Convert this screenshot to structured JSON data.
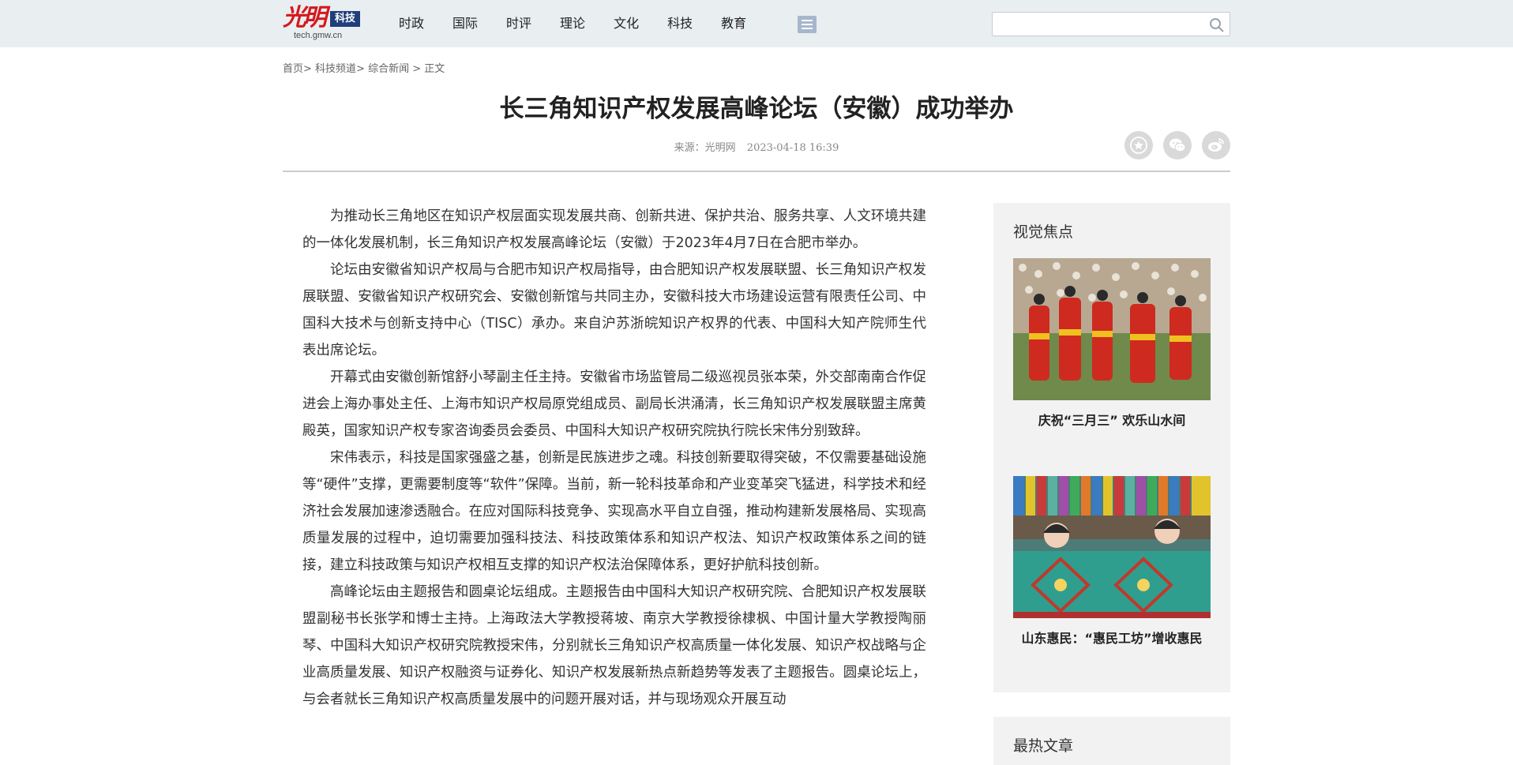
{
  "header": {
    "logo_brand": "光明",
    "logo_badge": "科技",
    "logo_url": "tech.gmw.cn",
    "nav": [
      "时政",
      "国际",
      "时评",
      "理论",
      "文化",
      "科技",
      "教育"
    ],
    "search": {
      "value": "",
      "placeholder": ""
    }
  },
  "breadcrumb": {
    "home": "首页",
    "channel": "科技频道",
    "section": "综合新闻",
    "current": "正文"
  },
  "article": {
    "title": "长三角知识产权发展高峰论坛（安徽）成功举办",
    "source": "来源：光明网",
    "datetime": "2023-04-18 16:39",
    "paragraphs": [
      "为推动长三角地区在知识产权层面实现发展共商、创新共进、保护共治、服务共享、人文环境共建的一体化发展机制，长三角知识产权发展高峰论坛（安徽）于2023年4月7日在合肥市举办。",
      "论坛由安徽省知识产权局与合肥市知识产权局指导，由合肥知识产权发展联盟、长三角知识产权发展联盟、安徽省知识产权研究会、安徽创新馆与共同主办，安徽科技大市场建设运营有限责任公司、中国科大技术与创新支持中心（TISC）承办。来自沪苏浙皖知识产权界的代表、中国科大知产院师生代表出席论坛。",
      "开幕式由安徽创新馆舒小琴副主任主持。安徽省市场监管局二级巡视员张本荣，外交部南南合作促进会上海办事处主任、上海市知识产权局原党组成员、副局长洪涌清，长三角知识产权发展联盟主席黄殿英，国家知识产权专家咨询委员会委员、中国科大知识产权研究院执行院长宋伟分别致辞。",
      "宋伟表示，科技是国家强盛之基，创新是民族进步之魂。科技创新要取得突破，不仅需要基础设施等“硬件”支撑，更需要制度等“软件”保障。当前，新一轮科技革命和产业变革突飞猛进，科学技术和经济社会发展加速渗透融合。在应对国际科技竞争、实现高水平自立自强，推动构建新发展格局、实现高质量发展的过程中，迫切需要加强科技法、科技政策体系和知识产权法、知识产权政策体系之间的链接，建立科技政策与知识产权相互支撑的知识产权法治保障体系，更好护航科技创新。",
      "高峰论坛由主题报告和圆桌论坛组成。主题报告由中国科大知识产权研究院、合肥知识产权发展联盟副秘书长张学和博士主持。上海政法大学教授蒋坡、南京大学教授徐棣枫、中国计量大学教授陶丽琴、中国科大知识产权研究院教授宋伟，分别就长三角知识产权高质量一体化发展、知识产权战略与企业高质量发展、知识产权融资与证券化、知识产权发展新热点新趋势等发表了主题报告。圆桌论坛上，与会者就长三角知识产权高质量发展中的问题开展对话，并与现场观众开展互动"
    ]
  },
  "sidebar": {
    "focus_title": "视觉焦点",
    "cards": [
      {
        "caption": "庆祝“三月三” 欢乐山水间"
      },
      {
        "caption": "山东惠民：“惠民工坊”增收惠民"
      }
    ],
    "hot_title": "最热文章"
  },
  "colors": {
    "header_bg": "#e9eef1",
    "brand_red": "#d4181e",
    "badge_blue": "#1f3e7a",
    "sidebar_bg": "#f2f2f2"
  },
  "icons": [
    "menu-icon",
    "search-icon",
    "star-icon",
    "wechat-icon",
    "weibo-icon"
  ]
}
